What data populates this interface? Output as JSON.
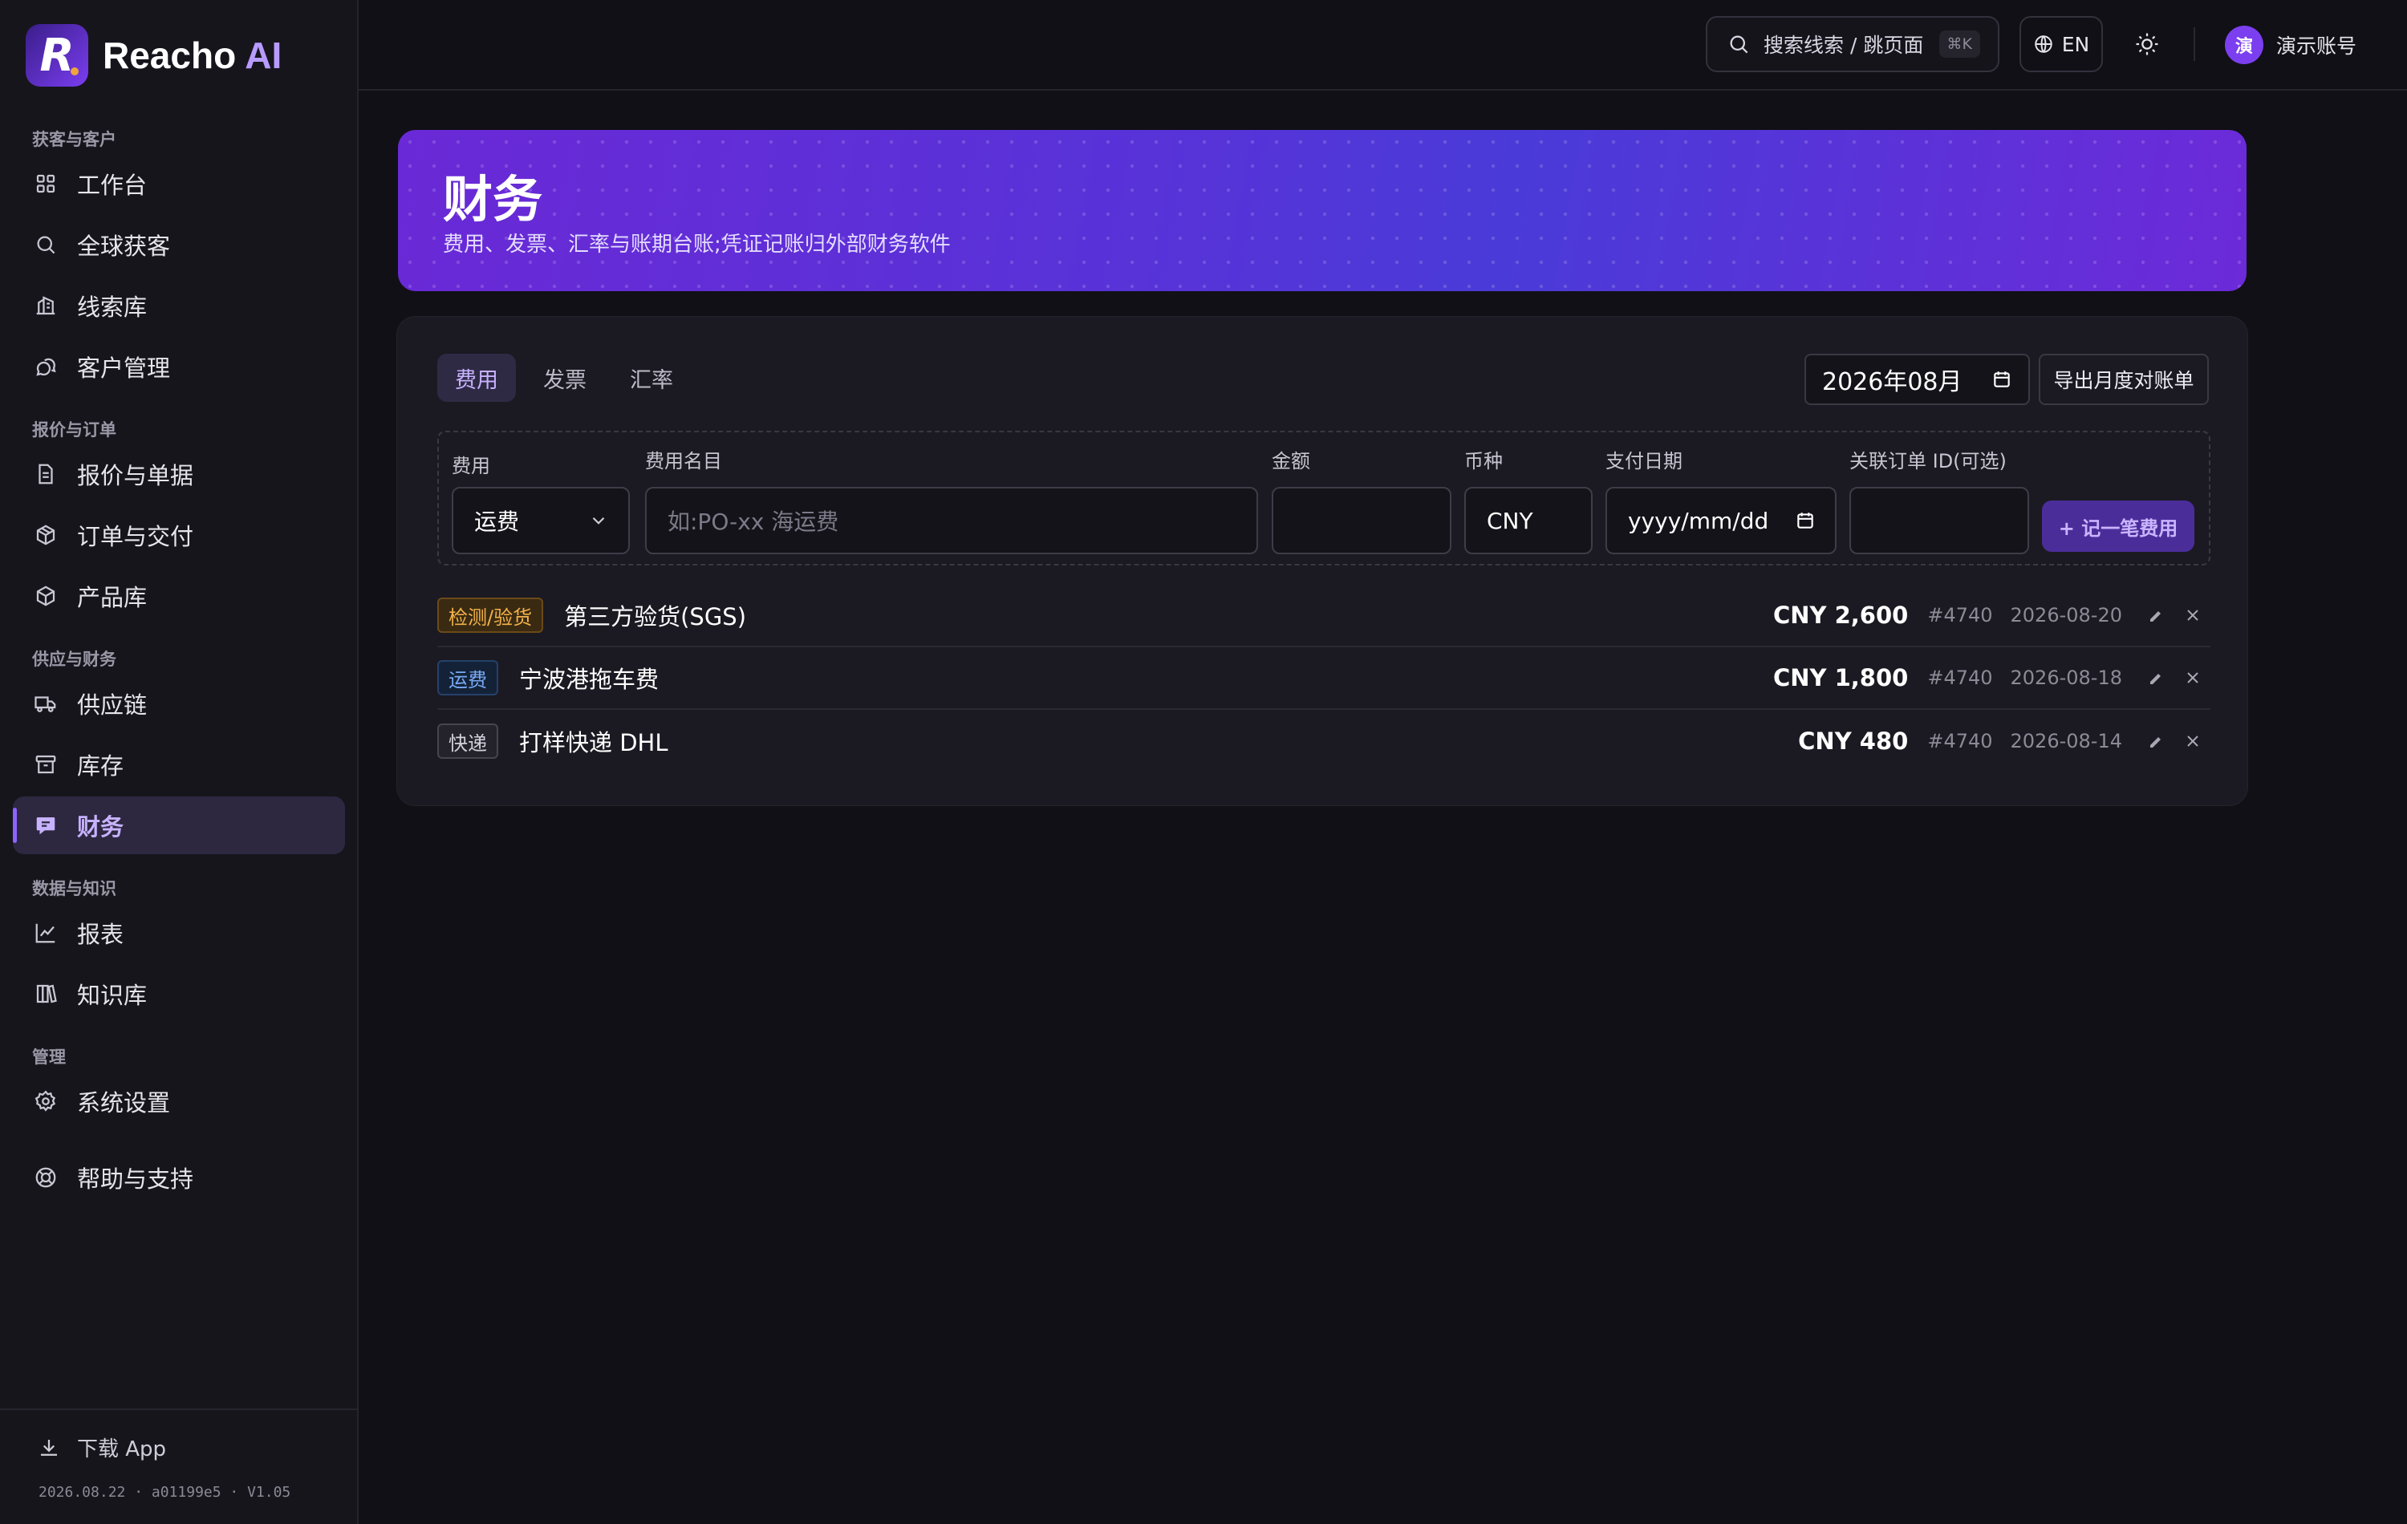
{
  "brand": {
    "name": "Reacho",
    "ai": "AI"
  },
  "sidebar": {
    "sections": [
      {
        "label": "获客与客户"
      },
      {
        "label": "报价与订单"
      },
      {
        "label": "供应与财务"
      },
      {
        "label": "数据与知识"
      },
      {
        "label": "管理"
      }
    ],
    "items": [
      {
        "label": "工作台",
        "icon": "grid-icon"
      },
      {
        "label": "全球获客",
        "icon": "search-icon"
      },
      {
        "label": "线索库",
        "icon": "building-icon"
      },
      {
        "label": "客户管理",
        "icon": "chat-icon"
      },
      {
        "label": "报价与单据",
        "icon": "document-icon"
      },
      {
        "label": "订单与交付",
        "icon": "box-icon"
      },
      {
        "label": "产品库",
        "icon": "cube-icon"
      },
      {
        "label": "供应链",
        "icon": "truck-icon"
      },
      {
        "label": "库存",
        "icon": "archive-icon"
      },
      {
        "label": "财务",
        "icon": "finance-icon",
        "active": true
      },
      {
        "label": "报表",
        "icon": "chart-icon"
      },
      {
        "label": "知识库",
        "icon": "books-icon"
      },
      {
        "label": "系统设置",
        "icon": "gear-icon"
      },
      {
        "label": "帮助与支持",
        "icon": "lifebuoy-icon"
      }
    ],
    "footer": {
      "download_label": "下载 App",
      "version": "2026.08.22 · a01199e5 · V1.05"
    }
  },
  "topbar": {
    "search_label": "搜索线索 / 跳页面",
    "search_shortcut": "⌘K",
    "language": "EN",
    "account_avatar": "演",
    "account_name": "演示账号"
  },
  "hero": {
    "title": "财务",
    "subtitle": "费用、发票、汇率与账期台账;凭证记账归外部财务软件"
  },
  "tabs": [
    {
      "label": "费用",
      "active": true
    },
    {
      "label": "发票"
    },
    {
      "label": "汇率"
    }
  ],
  "toolbar": {
    "month_value": "2026年08月",
    "export_label": "导出月度对账单"
  },
  "form": {
    "type_label": "费用",
    "type_value": "运费",
    "name_label": "费用名目",
    "name_placeholder": "如:PO-xx 海运费",
    "amount_label": "金额",
    "amount_value": "",
    "currency_label": "币种",
    "currency_value": "CNY",
    "date_label": "支付日期",
    "date_placeholder": "yyyy/mm/dd",
    "order_label": "关联订单 ID(可选)",
    "order_value": "",
    "submit_label": "+ 记一笔费用"
  },
  "expenses": [
    {
      "tag": "检测/验货",
      "tag_color": "#f3b24a",
      "title": "第三方验货(SGS)",
      "amount": "CNY 2,600",
      "order": "#4740",
      "date": "2026-08-20"
    },
    {
      "tag": "运费",
      "tag_color": "#78aaf5",
      "title": "宁波港拖车费",
      "amount": "CNY 1,800",
      "order": "#4740",
      "date": "2026-08-18"
    },
    {
      "tag": "快递",
      "tag_color": "#d3d1dc",
      "title": "打样快递 DHL",
      "amount": "CNY 480",
      "order": "#4740",
      "date": "2026-08-14"
    }
  ],
  "colors": {
    "accent": "#8d63ff",
    "background": "#111016",
    "hero_start": "#6a29d6",
    "hero_end": "#4a3bd8"
  }
}
